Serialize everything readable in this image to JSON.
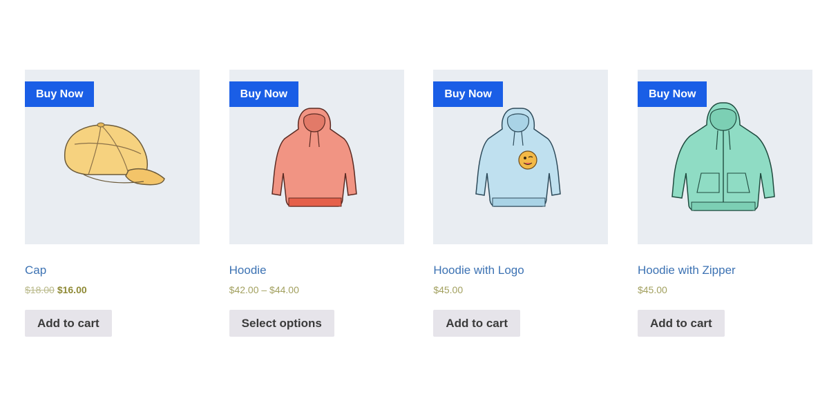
{
  "products": [
    {
      "badge": "Buy Now",
      "title": "Cap",
      "price_old": "$18.00",
      "price_new": "$16.00",
      "price": "",
      "button": "Add to cart",
      "illustration": "cap",
      "color": "#f6d27f"
    },
    {
      "badge": "Buy Now",
      "title": "Hoodie",
      "price_old": "",
      "price_new": "",
      "price": "$42.00 – $44.00",
      "button": "Select options",
      "illustration": "hoodie",
      "color": "#f19483"
    },
    {
      "badge": "Buy Now",
      "title": "Hoodie with Logo",
      "price_old": "",
      "price_new": "",
      "price": "$45.00",
      "button": "Add to cart",
      "illustration": "hoodie-with-logo",
      "color": "#bfe0ef"
    },
    {
      "badge": "Buy Now",
      "title": "Hoodie with Zipper",
      "price_old": "",
      "price_new": "",
      "price": "$45.00",
      "button": "Add to cart",
      "illustration": "hoodie-with-zipper",
      "color": "#8fdcc4"
    }
  ],
  "colors": {
    "badge_bg": "#1a5ee6",
    "title_link": "#3c72b3",
    "price": "#a2a05f",
    "button_bg": "#e6e4ea",
    "thumb_bg": "#e9edf2"
  }
}
